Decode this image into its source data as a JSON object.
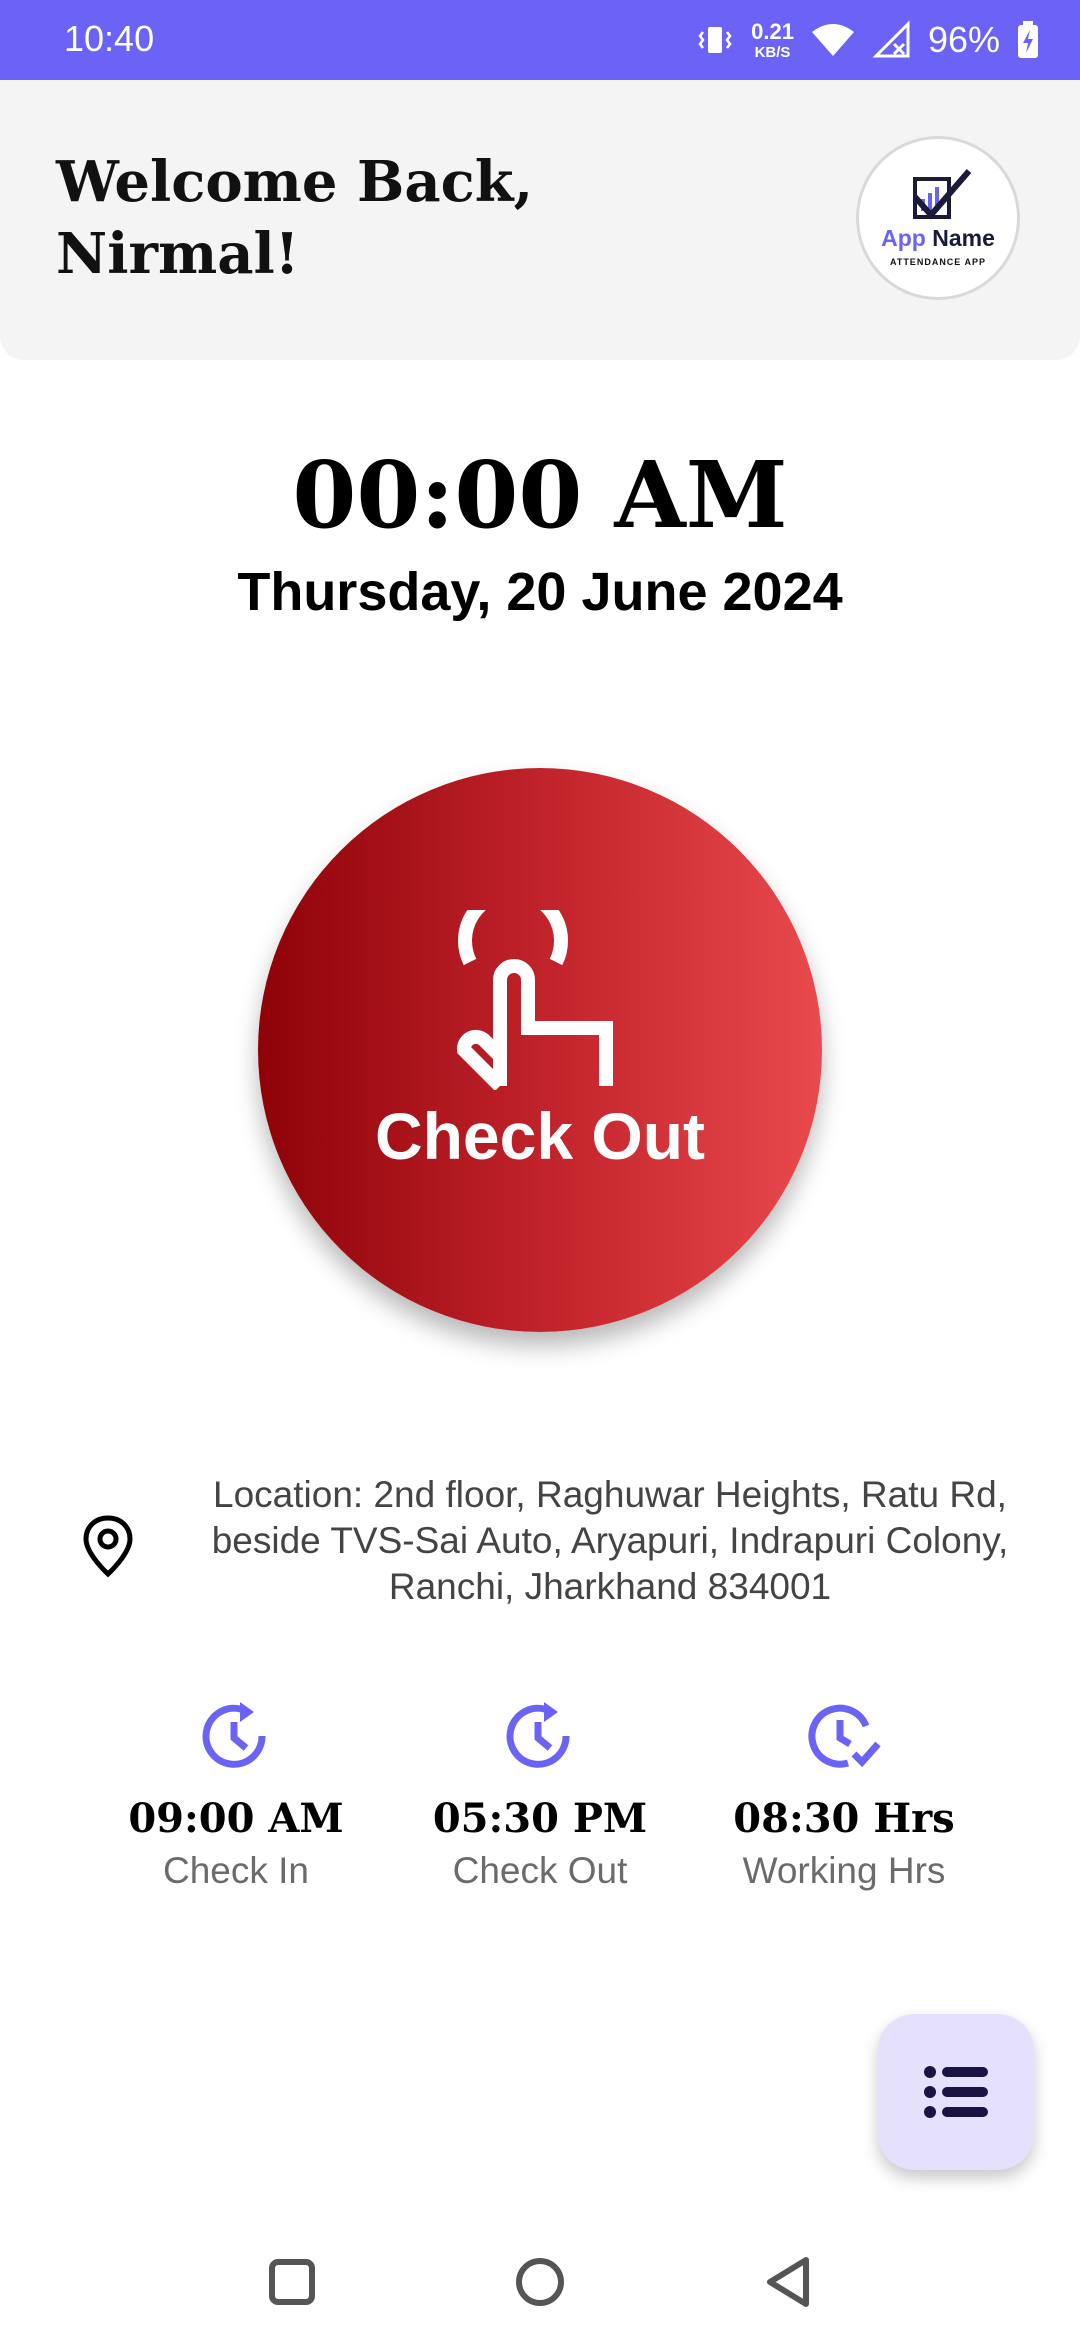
{
  "status_bar": {
    "time": "10:40",
    "net_speed_value": "0.21",
    "net_speed_unit": "KB/S",
    "battery": "96%"
  },
  "header": {
    "welcome_line1": "Welcome Back,",
    "welcome_line2": "Nirmal!",
    "logo_name_part1": "App",
    "logo_name_part2": "Name",
    "logo_subtitle": "ATTENDANCE APP"
  },
  "clock": {
    "time": "00:00 AM",
    "date": "Thursday, 20 June 2024"
  },
  "action_button": {
    "label": "Check Out"
  },
  "location": {
    "line1": "Location: 2nd floor, Raghuwar Heights, Ratu Rd,",
    "line2": "beside TVS-Sai Auto, Aryapuri, Indrapuri Colony,",
    "line3": "Ranchi, Jharkhand 834001"
  },
  "stats": [
    {
      "value": "09:00 AM",
      "label": "Check In",
      "icon": "clock-refresh-icon"
    },
    {
      "value": "05:30 PM",
      "label": "Check Out",
      "icon": "clock-refresh-icon"
    },
    {
      "value": "08:30 Hrs",
      "label": "Working Hrs",
      "icon": "clock-check-icon"
    }
  ],
  "colors": {
    "accent": "#6b63f6",
    "button_gradient_start": "#8e0208",
    "button_gradient_end": "#e94a4e",
    "fab_background": "#e5e1fc"
  },
  "icons": {
    "fab": "list-menu-icon",
    "nav": [
      "recents-square-icon",
      "home-circle-icon",
      "back-triangle-icon"
    ]
  }
}
